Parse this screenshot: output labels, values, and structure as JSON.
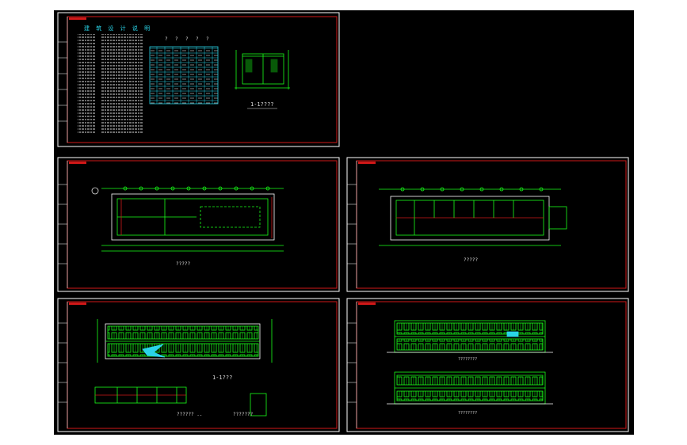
{
  "colors": {
    "background": "#000000",
    "frame": "#ffffff",
    "border": "#d01818",
    "lines": "#18ff18",
    "cyan": "#2ad4e8",
    "text": "#dddddd"
  },
  "sheets": [
    {
      "id": "design-notes",
      "title_cn": "建 筑 设 计 说 明",
      "table_headers": [
        "?",
        "?",
        "?",
        "?",
        "?"
      ],
      "section_label": "1-1????"
    },
    {
      "id": "ground-floor-plan",
      "caption": "?????"
    },
    {
      "id": "upper-floor-plan",
      "caption": "?????"
    },
    {
      "id": "roof-plan",
      "caption": "1-1???",
      "sub_caption_left": "?????? ..",
      "sub_caption_right": "???????"
    },
    {
      "id": "elevations",
      "caption_top": "????????",
      "caption_bottom": "????????"
    }
  ]
}
